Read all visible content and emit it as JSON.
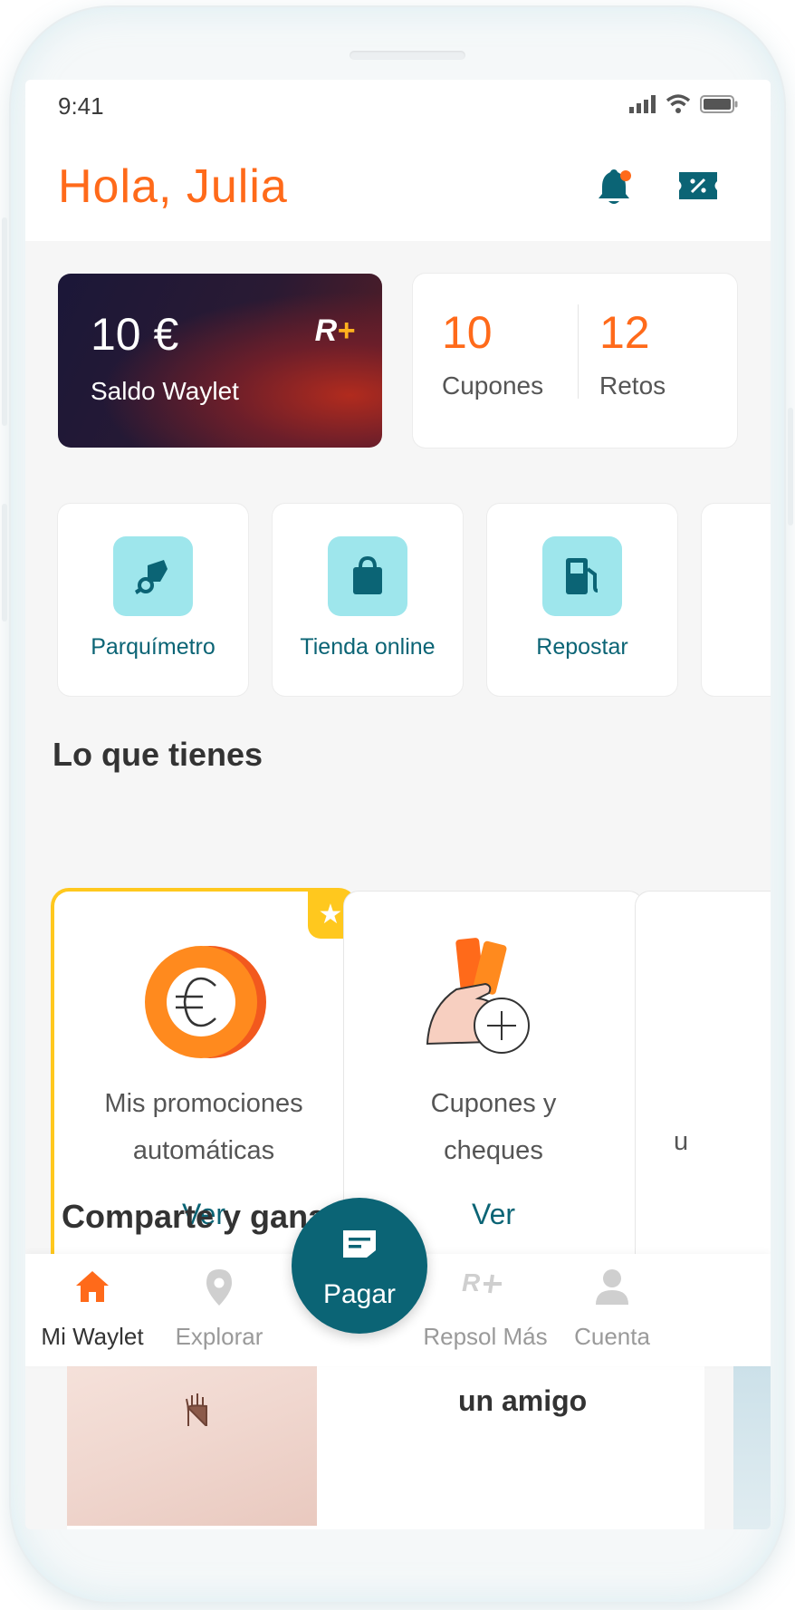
{
  "status_bar": {
    "time": "9:41"
  },
  "header": {
    "greeting": "Hola, Julia"
  },
  "balance_card": {
    "amount": "10 €",
    "label": "Saldo Waylet",
    "brand_r": "R",
    "brand_plus": "+"
  },
  "stats": [
    {
      "value": "10",
      "label": "Cupones"
    },
    {
      "value": "12",
      "label": "Retos"
    }
  ],
  "quick_actions": [
    {
      "label": "Parquímetro",
      "icon": "parking-meter-icon"
    },
    {
      "label": "Tienda online",
      "icon": "shopping-bag-icon"
    },
    {
      "label": "Repostar",
      "icon": "fuel-pump-icon"
    }
  ],
  "have_section": {
    "title": "Lo que tienes",
    "cards": [
      {
        "line1": "Mis promociones",
        "line2": "automáticas",
        "link": "Ver",
        "featured": true
      },
      {
        "line1": "Cupones y",
        "line2": "cheques",
        "link": "Ver",
        "featured": false
      }
    ],
    "peek_text": "u"
  },
  "share_section": {
    "title": "Comparte y gana",
    "card_title": "un amigo"
  },
  "pay_button": {
    "label": "Pagar"
  },
  "bottom_nav": [
    {
      "label": "Mi Waylet",
      "icon": "home-icon",
      "active": true
    },
    {
      "label": "Explorar",
      "icon": "location-pin-icon",
      "active": false
    },
    {
      "label": "Repsol Más",
      "icon": "repsol-plus-icon",
      "active": false
    },
    {
      "label": "Cuenta",
      "icon": "user-icon",
      "active": false
    }
  ],
  "colors": {
    "accent": "#ff6a1a",
    "primary": "#0b6475",
    "icon_bg": "#9ee6ec",
    "featured_border": "#ffc81e"
  }
}
